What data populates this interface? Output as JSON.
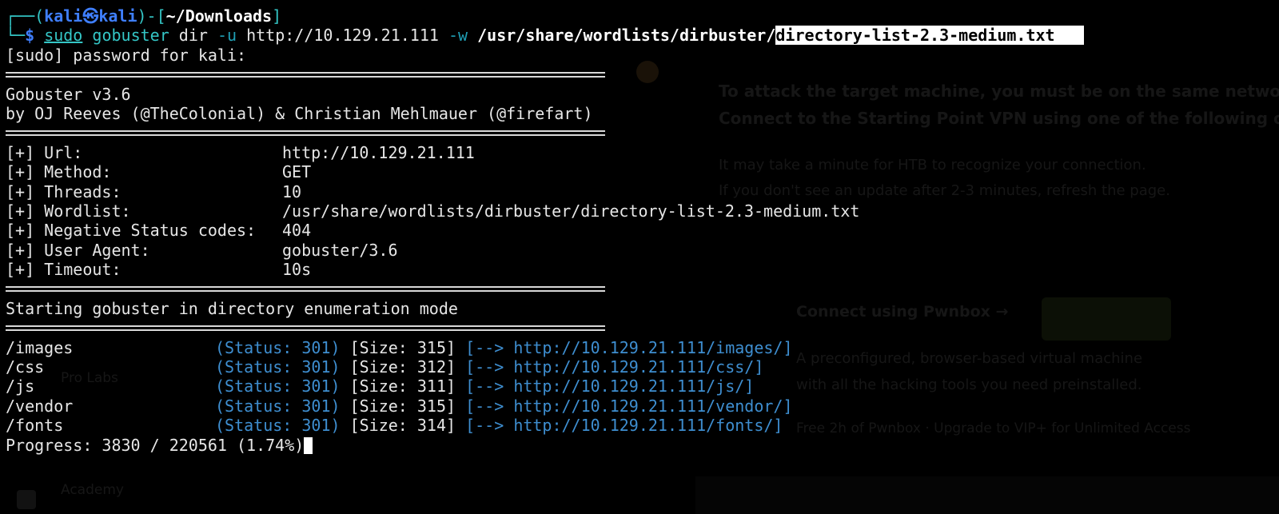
{
  "prompt": {
    "corner_top": "┌──(",
    "user": "kali",
    "at_icon": "㉿",
    "host": "kali",
    "sep": ")-[",
    "cwd": "~/Downloads",
    "close": "]",
    "corner_bottom": "└─",
    "dollar": "$",
    "sudo": "sudo",
    "prog": "gobuster",
    "subcmd": "dir",
    "flag_u": "-u",
    "url": "http://10.129.21.111",
    "flag_w": "-w",
    "wordlist_path": "/usr/share/wordlists/dirbuster/",
    "wordlist_file": "directory-list-2.3-medium.txt"
  },
  "sudo_prompt": "[sudo] password for kali:",
  "banner": {
    "title": "Gobuster v3.6",
    "authors": "by OJ Reeves (@TheColonial) & Christian Mehlmauer (@firefart)"
  },
  "config": [
    {
      "label": "[+] Url:",
      "value": "http://10.129.21.111"
    },
    {
      "label": "[+] Method:",
      "value": "GET"
    },
    {
      "label": "[+] Threads:",
      "value": "10"
    },
    {
      "label": "[+] Wordlist:",
      "value": "/usr/share/wordlists/dirbuster/directory-list-2.3-medium.txt"
    },
    {
      "label": "[+] Negative Status codes:",
      "value": "404"
    },
    {
      "label": "[+] User Agent:",
      "value": "gobuster/3.6"
    },
    {
      "label": "[+] Timeout:",
      "value": "10s"
    }
  ],
  "start_message": "Starting gobuster in directory enumeration mode",
  "results": [
    {
      "path": "/images",
      "status": "(Status: 301)",
      "size": "[Size: 315]",
      "arrow": "[-->",
      "link": "http://10.129.21.111/images/]"
    },
    {
      "path": "/css",
      "status": "(Status: 301)",
      "size": "[Size: 312]",
      "arrow": "[-->",
      "link": "http://10.129.21.111/css/]"
    },
    {
      "path": "/js",
      "status": "(Status: 301)",
      "size": "[Size: 311]",
      "arrow": "[-->",
      "link": "http://10.129.21.111/js/]"
    },
    {
      "path": "/vendor",
      "status": "(Status: 301)",
      "size": "[Size: 315]",
      "arrow": "[-->",
      "link": "http://10.129.21.111/vendor/]"
    },
    {
      "path": "/fonts",
      "status": "(Status: 301)",
      "size": "[Size: 314]",
      "arrow": "[-->",
      "link": "http://10.129.21.111/fonts/]"
    }
  ],
  "progress": "Progress: 3830 / 220561 (1.74%)",
  "background_page": {
    "line1": "To attack the target machine, you must be on the same network.",
    "line2": "Connect to the Starting Point VPN using one of the following opti",
    "note1": "It may take a minute for HTB to recognize your connection.",
    "note2": "If you don't see an update after 2-3 minutes, refresh the page.",
    "pwnbox_link": "Connect using Pwnbox →",
    "pwnbox_desc1": "A preconfigured, browser-based virtual machine",
    "pwnbox_desc2": "with all the hacking tools you need preinstalled.",
    "free_limit": "Free 2h of Pwnbox · Upgrade to VIP+ for Unlimited Access",
    "sidebar_item": "Pro Labs",
    "sidebar_item2": "Academy"
  },
  "colors": {
    "background": "#000000",
    "text": "#e6e6e6",
    "prompt_blue": "#3f7fff",
    "link_blue": "#3e8ed0",
    "flag_teal": "#1f9fb5"
  }
}
